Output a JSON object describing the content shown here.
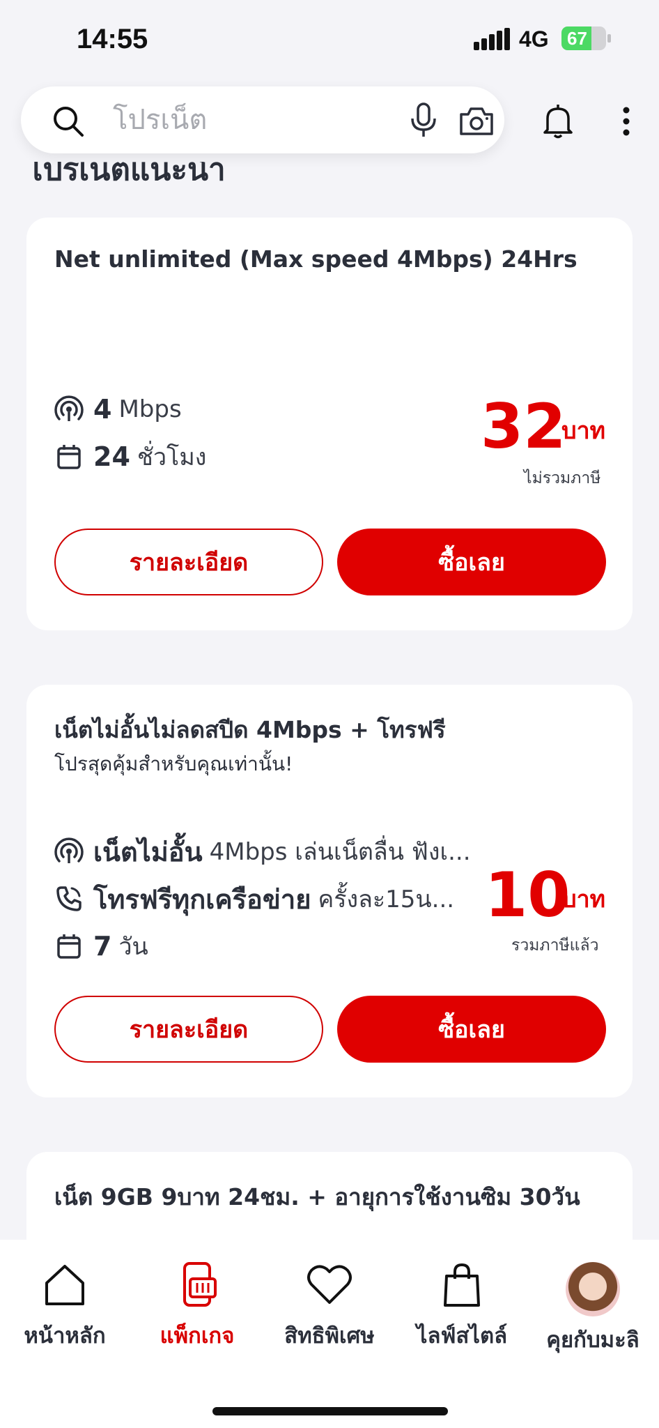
{
  "status_bar": {
    "time": "14:55",
    "network": "4G",
    "battery": "67",
    "battery_level": 0.67
  },
  "search": {
    "placeholder": "โปรเน็ต"
  },
  "section_title": "โปรเน็ตแนะนำ",
  "cards": [
    {
      "title": "Net unlimited (Max speed 4Mbps) 24Hrs",
      "features": [
        {
          "icon": "signal-icon",
          "strong": "4",
          "light": "Mbps"
        },
        {
          "icon": "calendar-icon",
          "strong": "24",
          "light": "ชั่วโมง"
        }
      ],
      "price": "32",
      "price_unit": "บาท",
      "price_note": "ไม่รวมภาษี",
      "detail_label": "รายละเอียด",
      "buy_label": "ซื้อเลย"
    },
    {
      "title": "เน็ตไม่อั้นไม่ลดสปีด 4Mbps + โทรฟรี",
      "subtitle": "โปรสุดคุ้มสำหรับคุณเท่านั้น!",
      "features": [
        {
          "icon": "signal-icon",
          "strong": "เน็ตไม่อั้น",
          "light": "4Mbps เล่นเน็ตลื่น ฟังเ..."
        },
        {
          "icon": "phone-icon",
          "strong": "โทรฟรีทุกเครือข่าย",
          "light": "ครั้งละ15น..."
        },
        {
          "icon": "calendar-icon",
          "strong": "7",
          "light": "วัน"
        }
      ],
      "price": "10",
      "price_unit": "บาท",
      "price_note": "รวมภาษีแล้ว",
      "detail_label": "รายละเอียด",
      "buy_label": "ซื้อเลย"
    },
    {
      "title": "เน็ต 9GB 9บาท 24ชม. + อายุการใช้งานซิม 30วัน"
    }
  ],
  "nav": [
    {
      "label": "หน้าหลัก",
      "icon": "home-icon"
    },
    {
      "label": "แพ็กเกจ",
      "icon": "package-icon",
      "active": true
    },
    {
      "label": "สิทธิพิเศษ",
      "icon": "heart-icon"
    },
    {
      "label": "ไลฟ์สไตล์",
      "icon": "shopping-bag-icon"
    },
    {
      "label": "คุยกับมะลิ",
      "icon": "avatar"
    }
  ],
  "colors": {
    "accent": "#e00000",
    "background": "#f4f4f8",
    "text": "#2b2f3a"
  }
}
